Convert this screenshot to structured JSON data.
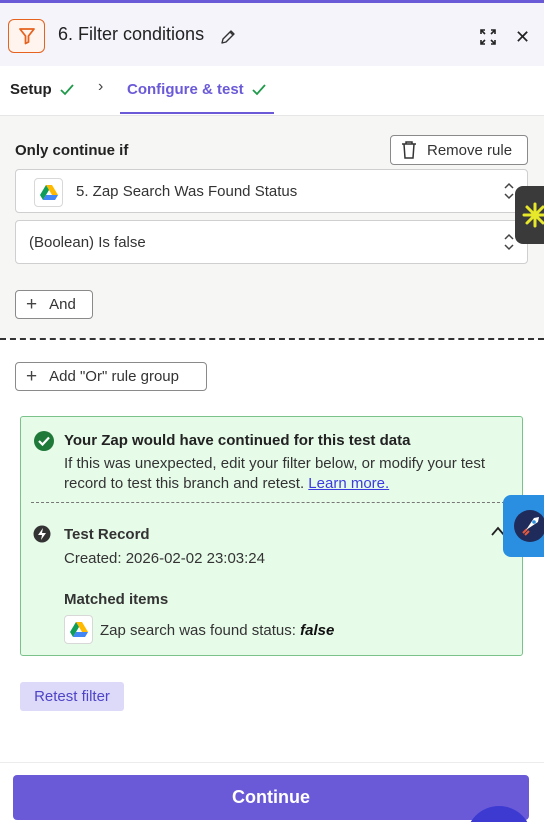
{
  "header": {
    "title": "6. Filter conditions",
    "step_icon": "filter-icon"
  },
  "tabs": [
    {
      "label": "Setup",
      "icon": "check-icon"
    },
    {
      "label": "Configure & test",
      "icon": "check-icon"
    }
  ],
  "rules": {
    "label": "Only continue if",
    "remove_label": "Remove rule",
    "field_value": "5. Zap Search Was Found Status",
    "condition_value": "(Boolean) Is false",
    "and_label": "And",
    "or_label": "Add \"Or\" rule group"
  },
  "result": {
    "heading": "Your Zap would have continued for this test data",
    "body": "If this was unexpected, edit your filter below, or modify your test record to test this branch and retest.",
    "learn_more": "Learn more.",
    "record_title": "Test Record",
    "created": "Created: 2026-02-02 23:03:24",
    "matched_heading": "Matched items",
    "match_label": "Zap search was found status:",
    "match_value": "false"
  },
  "retest_label": "Retest filter",
  "continue_label": "Continue",
  "colors": {
    "accent": "#6a5ad8",
    "success": "#1f7a3a",
    "filter_orange": "#e5621f"
  }
}
